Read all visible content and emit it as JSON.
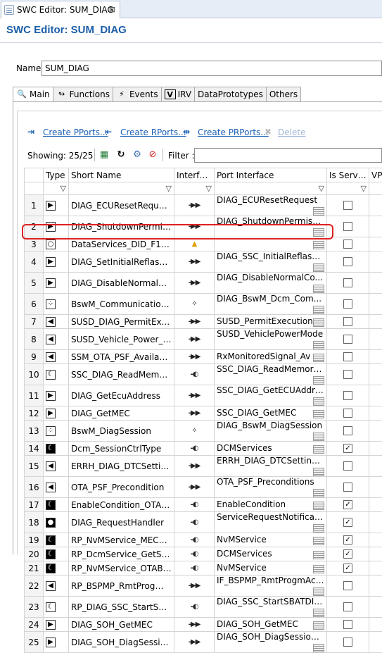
{
  "editor_tab": {
    "label": "SWC Editor: SUM_DIAG",
    "close": "⊠"
  },
  "title": "SWC Editor: SUM_DIAG",
  "name_label": "Name",
  "name_value": "SUM_DIAG",
  "tabs": [
    "Main",
    "Functions",
    "Events",
    "IRV",
    "DataPrototypes",
    "Others"
  ],
  "links": {
    "create_pports": "Create PPorts...",
    "create_rports": "Create RPorts...",
    "create_prports": "Create PRPorts...",
    "delete": "Delete"
  },
  "showing": "Showing: 25/25",
  "filter_label": "Filter :",
  "columns": [
    "",
    "Type",
    "Short Name",
    "Interface",
    "Port Interface",
    "Is Service",
    "VP"
  ],
  "rows": [
    {
      "n": "1",
      "t": "P",
      "name": "DIAG_ECUResetRequest",
      "pi": "DIAG_ECUResetRequest",
      "svc": false
    },
    {
      "n": "2",
      "t": "P",
      "name": "DIAG_ShutdownPermission",
      "pi": "DIAG_ShutdownPermissi...",
      "svc": false
    },
    {
      "n": "3",
      "t": "O",
      "name": "DataServices_DID_F1A0_M...",
      "pi": "",
      "svc": false
    },
    {
      "n": "4",
      "t": "P",
      "name": "DIAG_SetInitialReflashFlag",
      "pi": "DIAG_SSC_InitialReflashF...",
      "svc": false
    },
    {
      "n": "5",
      "t": "P",
      "name": "DIAG_DisableNormalCom...",
      "pi": "DIAG_DisableNormalCo...",
      "svc": false
    },
    {
      "n": "6",
      "t": "M",
      "name": "BswM_CommunicationM...",
      "pi": "DIAG_BswM_Dcm_Com...",
      "svc": false
    },
    {
      "n": "7",
      "t": "R",
      "name": "SUSD_DIAG_PermitExecuti...",
      "pi": "SUSD_PermitExecution",
      "svc": false
    },
    {
      "n": "8",
      "t": "R",
      "name": "SUSD_Vehicle_Power_Mode",
      "pi": "SUSD_VehiclePowerMode",
      "svc": false
    },
    {
      "n": "9",
      "t": "R",
      "name": "SSM_OTA_PSF_Availability",
      "pi": "RxMonitoredSignal_Av",
      "svc": false
    },
    {
      "n": "10",
      "t": "C",
      "name": "SSC_DIAG_ReadMemoryS...",
      "pi": "SSC_DIAG_ReadMemory...",
      "svc": false
    },
    {
      "n": "11",
      "t": "P",
      "name": "DIAG_GetEcuAddress",
      "pi": "SSC_DIAG_GetECUAddress",
      "svc": false
    },
    {
      "n": "12",
      "t": "P",
      "name": "DIAG_GetMEC",
      "pi": "SSC_DIAG_GetMEC",
      "svc": false
    },
    {
      "n": "13",
      "t": "M",
      "name": "BswM_DiagSession",
      "pi": "DIAG_BswM_DiagSession",
      "svc": false
    },
    {
      "n": "14",
      "t": "Cf",
      "name": "Dcm_SessionCtrlType",
      "pi": "DCMServices",
      "svc": true
    },
    {
      "n": "15",
      "t": "R",
      "name": "ERRH_DIAG_DTCSettingEn...",
      "pi": "ERRH_DIAG_DTCSettingE...",
      "svc": false
    },
    {
      "n": "16",
      "t": "R",
      "name": "OTA_PSF_Precondition",
      "pi": "OTA_PSF_Preconditions",
      "svc": false
    },
    {
      "n": "17",
      "t": "Cf",
      "name": "EnableCondition_OTA_PSF",
      "pi": "EnableCondition",
      "svc": true
    },
    {
      "n": "18",
      "t": "Of",
      "name": "DIAG_RequestHandler",
      "pi": "ServiceRequestNotificati...",
      "svc": true
    },
    {
      "n": "19",
      "t": "Cf",
      "name": "RP_NvMService_MECBlock",
      "pi": "NvMService",
      "svc": true
    },
    {
      "n": "20",
      "t": "Cf",
      "name": "RP_DcmService_GetSecuri...",
      "pi": "DCMServices",
      "svc": true
    },
    {
      "n": "21",
      "t": "Cf",
      "name": "RP_NvMService_OTABlock",
      "pi": "NvMService",
      "svc": true
    },
    {
      "n": "22",
      "t": "R",
      "name": "RP_BSPMP_RmtProgmAct...",
      "pi": "IF_BSPMP_RmtProgmAct...",
      "svc": false
    },
    {
      "n": "23",
      "t": "C",
      "name": "RP_DIAG_SSC_StartSBATDI...",
      "pi": "DIAG_SSC_StartSBATDID...",
      "svc": false
    },
    {
      "n": "24",
      "t": "P",
      "name": "DIAG_SOH_GetMEC",
      "pi": "DIAG_SOH_GetMEC",
      "svc": false
    },
    {
      "n": "25",
      "t": "P",
      "name": "DIAG_SOH_DiagSessionRe...",
      "pi": "DIAG_SOH_DiagSessionR...",
      "svc": false
    }
  ]
}
